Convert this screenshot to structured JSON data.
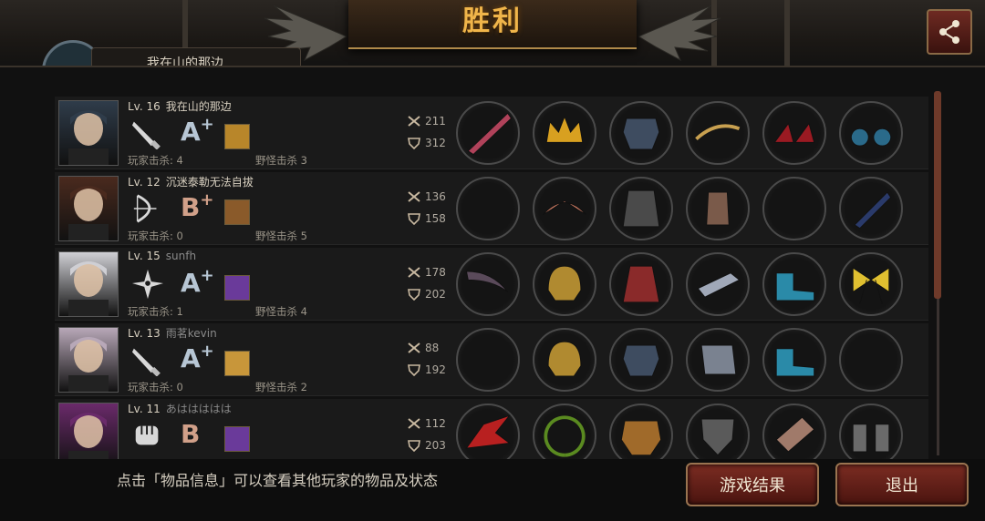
{
  "header": {
    "title": "胜利",
    "top_player_name": "我在山的那边"
  },
  "players": [
    {
      "level": "Lv. 16",
      "name": "我在山的那边",
      "name_dim": false,
      "weapon_icon": "knife-icon",
      "grade": "A",
      "grade_plus": "+",
      "skill_color": "#b8862a",
      "player_kills": "玩家击杀: 4",
      "monster_kills": "野怪击杀 3",
      "attack": "211",
      "defense": "312",
      "portrait_color": "#2f3c4a",
      "items": [
        "blade-icon",
        "crown-icon",
        "armor-icon",
        "whip-icon",
        "heels-icon",
        "earrings-icon"
      ]
    },
    {
      "level": "Lv. 12",
      "name": "沉迷泰勒无法自拔",
      "name_dim": false,
      "weapon_icon": "bow-icon",
      "grade": "B",
      "grade_plus": "+",
      "skill_color": "#8a5a2a",
      "player_kills": "玩家击杀: 0",
      "monster_kills": "野怪击杀 5",
      "attack": "136",
      "defense": "158",
      "portrait_color": "#4a2a1e",
      "items": [
        "bow-icon",
        "tiara-icon",
        "cloak-icon",
        "bracer-icon",
        "empty",
        "quiver-icon"
      ]
    },
    {
      "level": "Lv. 15",
      "name": "sunfh",
      "name_dim": true,
      "weapon_icon": "shuriken-icon",
      "grade": "A",
      "grade_plus": "+",
      "skill_color": "#6a3a9a",
      "player_kills": "玩家击杀: 1",
      "monster_kills": "野怪击杀 4",
      "attack": "178",
      "defense": "202",
      "portrait_color": "#cfcfd4",
      "items": [
        "boomerang-icon",
        "helmet-icon",
        "robe-icon",
        "gauntlet-icon",
        "boots-icon",
        "ribbon-icon"
      ]
    },
    {
      "level": "Lv. 13",
      "name": "雨茗kevin",
      "name_dim": true,
      "weapon_icon": "knife-icon",
      "grade": "A",
      "grade_plus": "+",
      "skill_color": "#c8963a",
      "player_kills": "玩家击杀: 0",
      "monster_kills": "野怪击杀 2",
      "attack": "88",
      "defense": "192",
      "portrait_color": "#b8a8b8",
      "items": [
        "empty",
        "helmet-icon",
        "armor-icon",
        "spiked-gauntlet-icon",
        "boots-icon",
        "empty"
      ]
    },
    {
      "level": "Lv. 11",
      "name": "あははははは",
      "name_dim": true,
      "weapon_icon": "fist-icon",
      "grade": "B",
      "grade_plus": "",
      "skill_color": "#6a3a9a",
      "player_kills": "",
      "monster_kills": "",
      "attack": "112",
      "defense": "203",
      "portrait_color": "#6a2a6a",
      "items": [
        "claw-icon",
        "laurel-icon",
        "chest-armor-icon",
        "shield-icon",
        "bandage-icon",
        "binoculars-icon"
      ]
    }
  ],
  "footer": {
    "hint": "点击「物品信息」可以查看其他玩家的物品及状态",
    "result_button": "游戏结果",
    "exit_button": "退出"
  },
  "colors": {
    "title": "#f0b54a",
    "button_fill": "#7b2c22",
    "button_border": "#9a7450"
  }
}
